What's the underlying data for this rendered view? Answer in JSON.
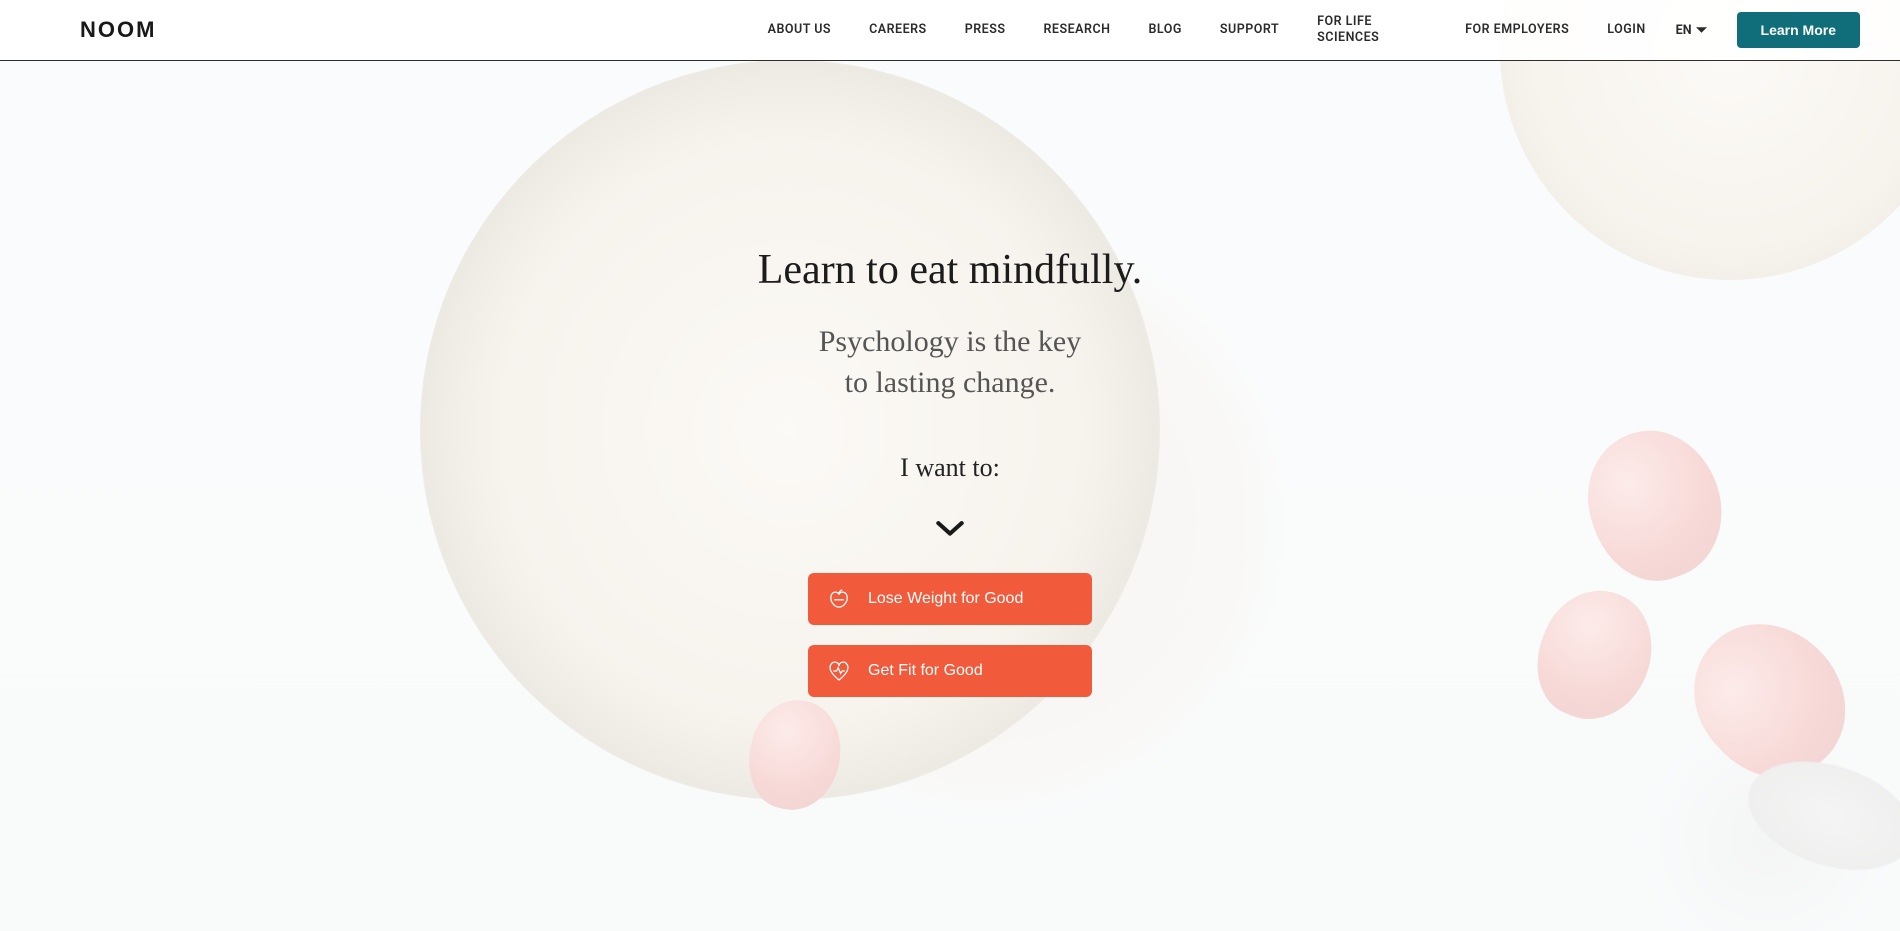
{
  "brand": "NOOM",
  "nav": {
    "items": [
      "ABOUT US",
      "CAREERS",
      "PRESS",
      "RESEARCH",
      "BLOG",
      "SUPPORT",
      "FOR LIFE SCIENCES",
      "FOR EMPLOYERS"
    ],
    "login": "LOGIN",
    "language": "EN",
    "cta": "Learn More"
  },
  "hero": {
    "headline": "Learn to eat mindfully.",
    "subhead_line1": "Psychology is the key",
    "subhead_line2": "to lasting change.",
    "prompt": "I want to:",
    "options": [
      {
        "label": "Lose Weight for Good",
        "icon": "apple-icon"
      },
      {
        "label": "Get Fit for Good",
        "icon": "heart-pulse-icon"
      }
    ]
  },
  "colors": {
    "accent_button": "#f15a3b",
    "cta_teal": "#0f6e79"
  }
}
